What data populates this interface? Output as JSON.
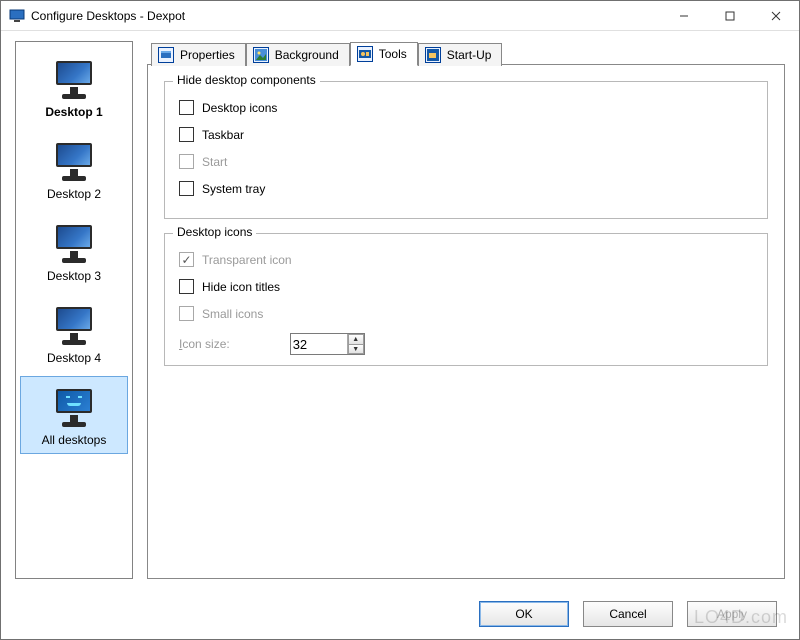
{
  "window": {
    "title": "Configure Desktops - Dexpot"
  },
  "sidebar": {
    "items": [
      {
        "label": "Desktop 1"
      },
      {
        "label": "Desktop 2"
      },
      {
        "label": "Desktop 3"
      },
      {
        "label": "Desktop 4"
      },
      {
        "label": "All desktops"
      }
    ]
  },
  "tabs": {
    "properties": "Properties",
    "background": "Background",
    "tools": "Tools",
    "startup": "Start-Up"
  },
  "groups": {
    "hide_components": "Hide desktop components",
    "desktop_icons": "Desktop icons"
  },
  "options": {
    "desktop_icons": "Desktop icons",
    "taskbar": "Taskbar",
    "start": "Start",
    "system_tray": "System tray",
    "transparent_icon": "Transparent icon",
    "hide_icon_titles": "Hide icon titles",
    "small_icons": "Small icons",
    "icon_size_label": "Icon size:",
    "icon_size_value": "32"
  },
  "buttons": {
    "ok": "OK",
    "cancel": "Cancel",
    "apply": "Apply"
  },
  "watermark": "LO4D.com"
}
